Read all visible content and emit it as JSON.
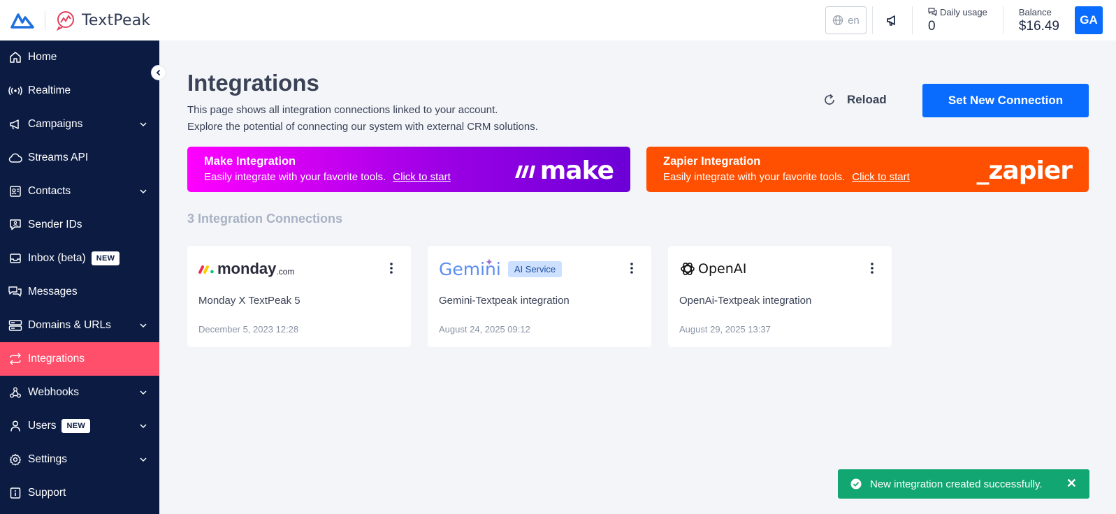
{
  "brand": {
    "name": "TextPeak"
  },
  "header": {
    "language": "en",
    "daily_usage_label": "Daily usage",
    "daily_usage_value": "0",
    "balance_label": "Balance",
    "balance_value": "$16.49",
    "avatar_initials": "GA"
  },
  "sidebar": {
    "items": [
      {
        "label": "Home",
        "icon": "home-icon"
      },
      {
        "label": "Realtime",
        "icon": "broadcast-icon"
      },
      {
        "label": "Campaigns",
        "icon": "megaphone-icon",
        "expandable": true
      },
      {
        "label": "Streams API",
        "icon": "cloud-icon"
      },
      {
        "label": "Contacts",
        "icon": "contact-card-icon",
        "expandable": true
      },
      {
        "label": "Sender IDs",
        "icon": "sender-id-icon"
      },
      {
        "label": "Inbox (beta)",
        "icon": "inbox-icon",
        "badge": "NEW"
      },
      {
        "label": "Messages",
        "icon": "messages-icon"
      },
      {
        "label": "Domains & URLs",
        "icon": "server-icon",
        "expandable": true
      },
      {
        "label": "Integrations",
        "icon": "arrows-exchange-icon",
        "active": true
      },
      {
        "label": "Webhooks",
        "icon": "webhook-icon",
        "expandable": true
      },
      {
        "label": "Users",
        "icon": "user-icon",
        "badge": "NEW",
        "expandable": true
      },
      {
        "label": "Settings",
        "icon": "gear-icon",
        "expandable": true
      },
      {
        "label": "Support",
        "icon": "support-icon"
      }
    ]
  },
  "main": {
    "title": "Integrations",
    "description_line1": "This page shows all integration connections linked to your account.",
    "description_line2": "Explore the potential of connecting our system with external CRM solutions.",
    "reload_label": "Reload",
    "new_connection_label": "Set New Connection",
    "promos": [
      {
        "title": "Make Integration",
        "desc": "Easily integrate with your favorite tools.",
        "link": "Click to start",
        "logo": "make"
      },
      {
        "title": "Zapier Integration",
        "desc": "Easily integrate with your favorite tools.",
        "link": "Click to start",
        "logo": "_zapier"
      }
    ],
    "connections_title": "3 Integration Connections",
    "cards": [
      {
        "logo": "monday",
        "logo_suffix": ".com",
        "name": "Monday X TextPeak 5",
        "date": "December 5, 2023 12:28"
      },
      {
        "logo": "Gemini",
        "tag": "AI Service",
        "name": "Gemini-Textpeak integration",
        "date": "August 24, 2025 09:12"
      },
      {
        "logo": "OpenAI",
        "name": "OpenAi-Textpeak integration",
        "date": "August 29, 2025 13:37"
      }
    ]
  },
  "toast": {
    "message": "New integration created successfully.",
    "close": "✕"
  },
  "colors": {
    "sidebar": "#0b1b42",
    "active": "#ff4f6b",
    "primary": "#0a6cff",
    "make_gradient_start": "#ff00ff",
    "make_gradient_end": "#6b00d6",
    "zapier": "#ff4f00",
    "toast": "#12a772"
  }
}
